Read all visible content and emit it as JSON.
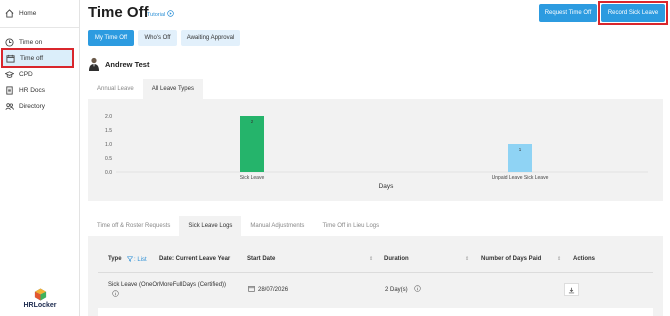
{
  "sidebar": {
    "items": [
      {
        "label": "Home",
        "icon": "home-icon"
      },
      {
        "label": "Time on",
        "icon": "clock-icon"
      },
      {
        "label": "Time off",
        "icon": "calendar-icon"
      },
      {
        "label": "CPD",
        "icon": "graduation-cap-icon"
      },
      {
        "label": "HR Docs",
        "icon": "document-icon"
      },
      {
        "label": "Directory",
        "icon": "people-icon"
      }
    ],
    "logo_text": "HRLocker"
  },
  "header": {
    "title": "Time Off",
    "tutorial_label": "Tutorial",
    "request_button": "Request Time Off",
    "record_button": "Record Sick Leave"
  },
  "filters": {
    "my_time_off": "My Time Off",
    "whos_off": "Who's Off",
    "awaiting_approval": "Awaiting Approval"
  },
  "user": {
    "name": "Andrew Test"
  },
  "leave_tabs": {
    "annual": "Annual Leave",
    "all": "All Leave Types"
  },
  "chart_data": {
    "type": "bar",
    "categories": [
      "Sick Leave",
      "Unpaid Leave Sick Leave"
    ],
    "values": [
      2,
      1
    ],
    "value_labels": [
      "2",
      "1"
    ],
    "colors": [
      "#25b46b",
      "#8fd3f4"
    ],
    "xlabel": "Days",
    "ylabel": "",
    "ylim": [
      0,
      2.0
    ],
    "yticks": [
      "0.0",
      "0.5",
      "1.0",
      "1.5",
      "2.0"
    ]
  },
  "log_tabs": {
    "requests": "Time off & Roster Requests",
    "sick_logs": "Sick Leave Logs",
    "adjustments": "Manual Adjustments",
    "lieu": "Time Off in Lieu Logs"
  },
  "table": {
    "headers": {
      "type": "Type",
      "list_link": ": List",
      "date_filter": "Date: Current Leave Year",
      "start_date": "Start Date",
      "duration": "Duration",
      "days_paid": "Number of Days Paid",
      "actions": "Actions"
    },
    "rows": [
      {
        "type": "Sick Leave (OneOrMoreFullDays (Certified))",
        "start_date": "28/07/2026",
        "duration": "2 Day(s)"
      }
    ]
  }
}
